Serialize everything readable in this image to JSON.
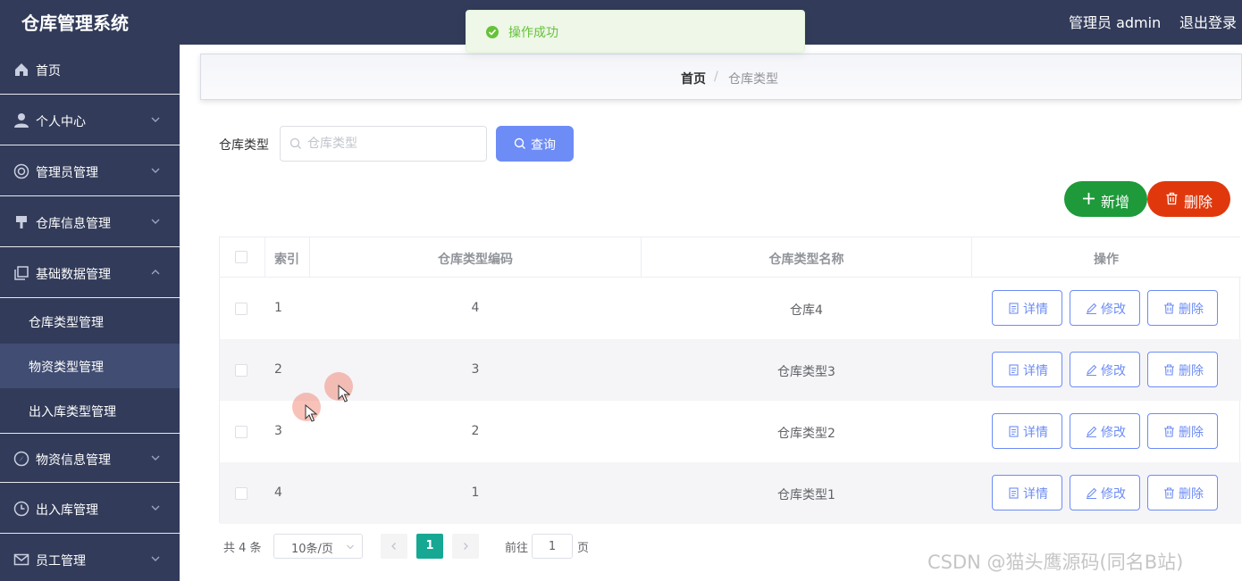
{
  "header": {
    "app_title": "仓库管理系统",
    "user_label": "管理员 admin",
    "logout_label": "退出登录"
  },
  "sidebar": {
    "items": [
      {
        "label": "首页",
        "icon": "home-icon"
      },
      {
        "label": "个人中心",
        "icon": "user-icon"
      },
      {
        "label": "管理员管理",
        "icon": "admin-icon"
      },
      {
        "label": "仓库信息管理",
        "icon": "warehouse-icon"
      },
      {
        "label": "基础数据管理",
        "icon": "copy-icon",
        "expanded": true
      },
      {
        "label": "物资信息管理",
        "icon": "compass-icon"
      },
      {
        "label": "出入库管理",
        "icon": "clock-icon"
      },
      {
        "label": "员工管理",
        "icon": "mail-icon"
      }
    ],
    "sub_items": [
      {
        "label": "仓库类型管理"
      },
      {
        "label": "物资类型管理",
        "active": true
      },
      {
        "label": "出入库类型管理"
      }
    ]
  },
  "breadcrumb": {
    "home": "首页",
    "separator": "/",
    "current": "仓库类型"
  },
  "search": {
    "label": "仓库类型",
    "placeholder": "仓库类型",
    "value": "",
    "button_label": "查询"
  },
  "actions": {
    "add_label": "新增",
    "delete_label": "删除"
  },
  "table": {
    "headers": {
      "index": "索引",
      "code": "仓库类型编码",
      "name": "仓库类型名称",
      "ops": "操作"
    },
    "rows": [
      {
        "index": "1",
        "code": "4",
        "name": "仓库4"
      },
      {
        "index": "2",
        "code": "3",
        "name": "仓库类型3"
      },
      {
        "index": "3",
        "code": "2",
        "name": "仓库类型2"
      },
      {
        "index": "4",
        "code": "1",
        "name": "仓库类型1"
      }
    ],
    "row_actions": {
      "detail": "详情",
      "edit": "修改",
      "delete": "删除"
    }
  },
  "pagination": {
    "total": "共 4 条",
    "page_size": "10条/页",
    "current_page": "1",
    "goto_label": "前往",
    "goto_value": "1",
    "page_suffix": "页"
  },
  "toast": {
    "message": "操作成功"
  },
  "watermark": "CSDN @猫头鹰源码(同名B站)",
  "colors": {
    "sidebar_bg": "#323b59",
    "primary": "#6d8cf6",
    "success": "#1e9a3a",
    "danger": "#e0380c",
    "page_active": "#16a893"
  }
}
